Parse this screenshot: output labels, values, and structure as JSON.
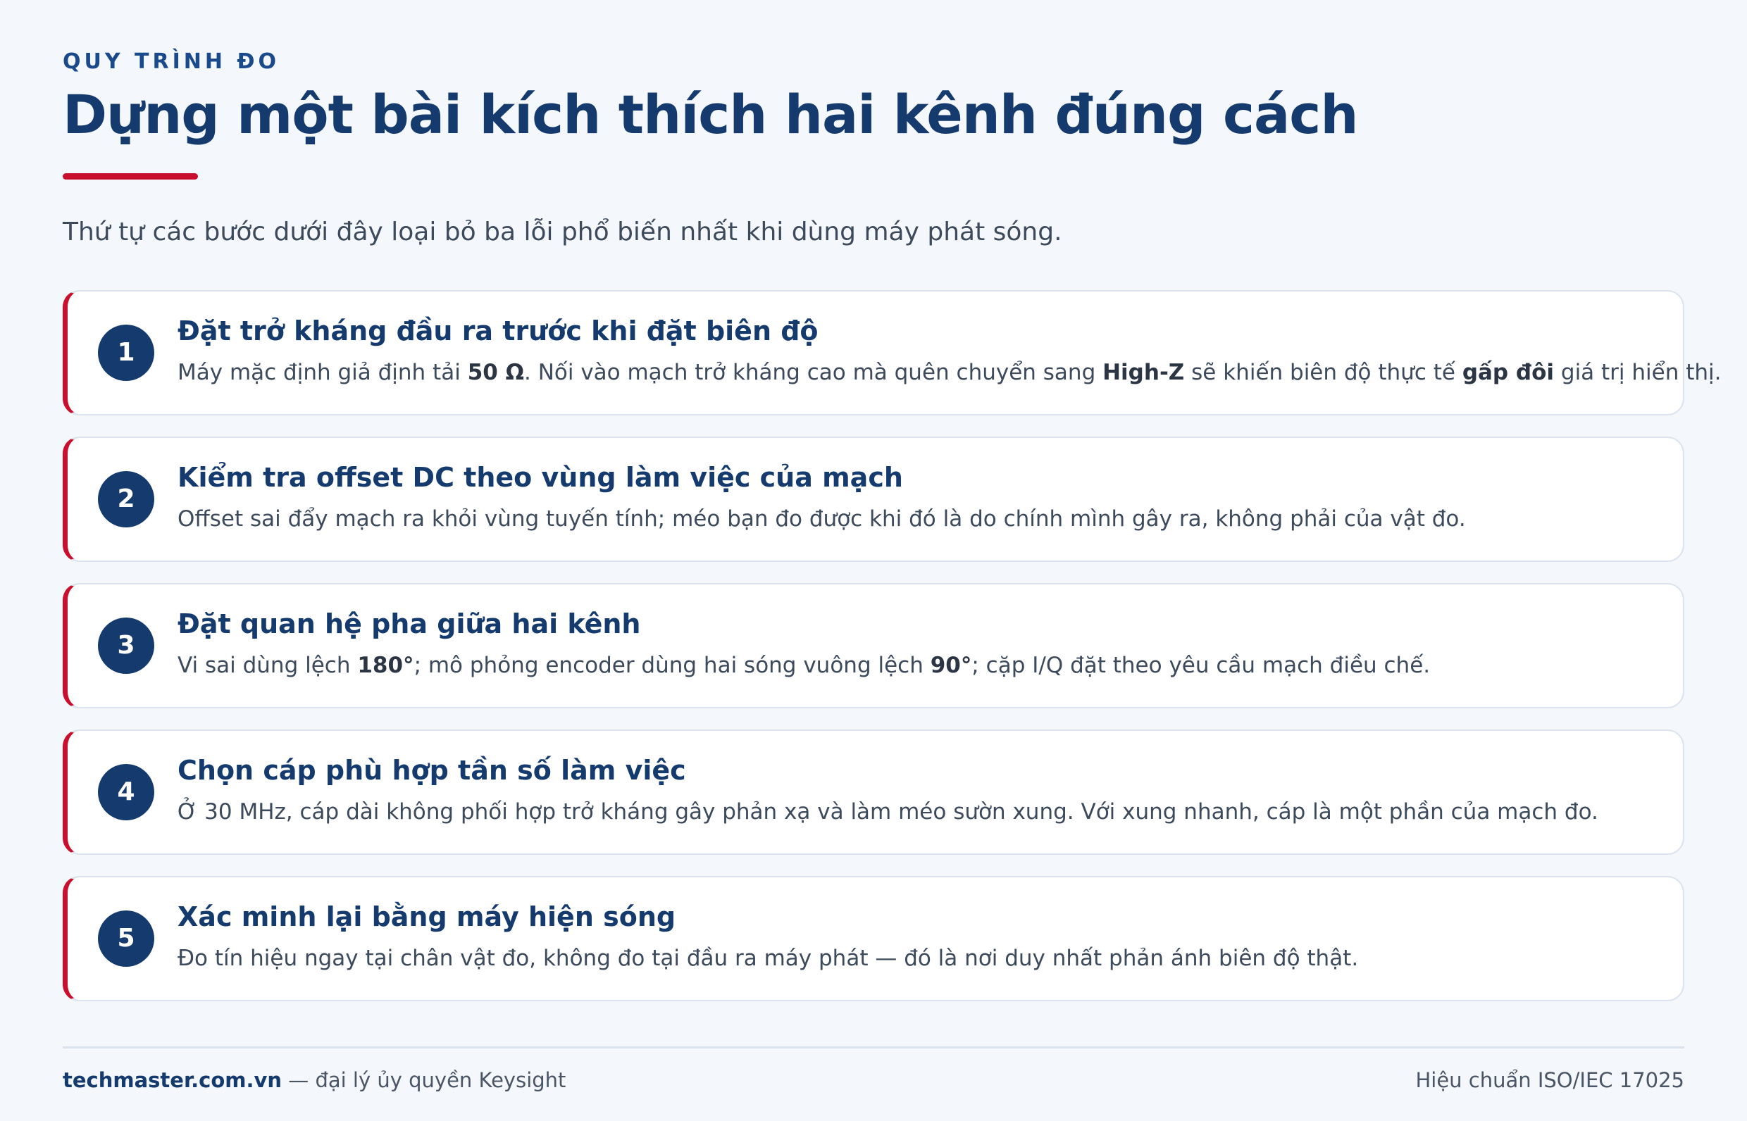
{
  "header": {
    "eyebrow": "QUY TRÌNH ĐO",
    "title": "Dựng một bài kích thích hai kênh đúng cách",
    "subtitle": "Thứ tự các bước dưới đây loại bỏ ba lỗi phổ biến nhất khi dùng máy phát sóng."
  },
  "steps": [
    {
      "number": "1",
      "title": "Đặt trở kháng đầu ra trước khi đặt biên độ",
      "description": [
        {
          "text": "Máy mặc định giả định tải "
        },
        {
          "text": "50 Ω",
          "bold": true
        },
        {
          "text": ". Nối vào mạch trở kháng cao mà quên chuyển sang "
        },
        {
          "text": "High-Z",
          "bold": true
        },
        {
          "text": " sẽ khiến biên độ thực tế "
        },
        {
          "text": "gấp đôi",
          "bold": true
        },
        {
          "text": " giá trị hiển thị."
        }
      ]
    },
    {
      "number": "2",
      "title": "Kiểm tra offset DC theo vùng làm việc của mạch",
      "description": [
        {
          "text": "Offset sai đẩy mạch ra khỏi vùng tuyến tính; méo bạn đo được khi đó là do chính mình gây ra, không phải của vật đo."
        }
      ]
    },
    {
      "number": "3",
      "title": "Đặt quan hệ pha giữa hai kênh",
      "description": [
        {
          "text": "Vi sai dùng lệch "
        },
        {
          "text": "180°",
          "bold": true
        },
        {
          "text": "; mô phỏng encoder dùng hai sóng vuông lệch "
        },
        {
          "text": "90°",
          "bold": true
        },
        {
          "text": "; cặp I/Q đặt theo yêu cầu mạch điều chế."
        }
      ]
    },
    {
      "number": "4",
      "title": "Chọn cáp phù hợp tần số làm việc",
      "description": [
        {
          "text": "Ở 30 MHz, cáp dài không phối hợp trở kháng gây phản xạ và làm méo sườn xung. Với xung nhanh, cáp là một phần của mạch đo."
        }
      ]
    },
    {
      "number": "5",
      "title": "Xác minh lại bằng máy hiện sóng",
      "description": [
        {
          "text": "Đo tín hiệu ngay tại chân vật đo, không đo tại đầu ra máy phát — đó là nơi duy nhất phản ánh biên độ thật."
        }
      ]
    }
  ],
  "footer": {
    "brand": "techmaster.com.vn",
    "tagline": " — đại lý ủy quyền Keysight",
    "certification": "Hiệu chuẩn ISO/IEC 17025"
  },
  "colors": {
    "accent": "#c8102e",
    "navy": "#143a6e",
    "background": "#f4f7fb"
  }
}
